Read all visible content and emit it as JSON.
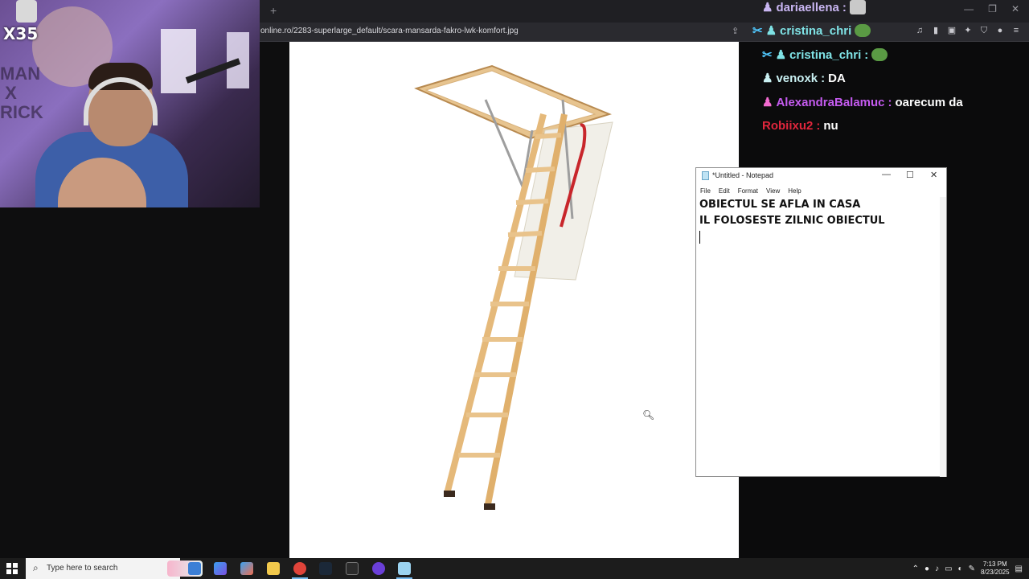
{
  "browser": {
    "url": "online.ro/2283-superlarge_default/scara-mansarda-fakro-lwk-komfort.jpg",
    "new_tab": "+"
  },
  "webcam": {
    "badge": "X35",
    "shirt_text": "MAN\nX\nRICK"
  },
  "chat": {
    "messages": [
      {
        "user": "dariaellena",
        "text": "",
        "color": "#c9b6f2"
      },
      {
        "user": "cristina_chri",
        "text": "",
        "color": "#7fe3e6"
      },
      {
        "user": "cristina_chri",
        "text": "",
        "color": "#7fe3e6"
      },
      {
        "user": "venoxk",
        "text": "DA",
        "color": "#c9f0f2"
      },
      {
        "user": "AlexandraBalamuc",
        "text": "oarecum da",
        "color": "#c55bf0"
      },
      {
        "user": "Robiixu2",
        "text": "nu",
        "color": "#e0263c"
      }
    ]
  },
  "notepad": {
    "title": "*Untitled - Notepad",
    "menu": [
      "File",
      "Edit",
      "Format",
      "View",
      "Help"
    ],
    "lines": [
      "OBIECTUL SE AFLA IN CASA",
      "IL FOLOSESTE ZILNIC OBIECTUL"
    ]
  },
  "taskbar": {
    "search_placeholder": "Type here to search",
    "time": "7:13 PM",
    "date": "8/23/2025"
  }
}
